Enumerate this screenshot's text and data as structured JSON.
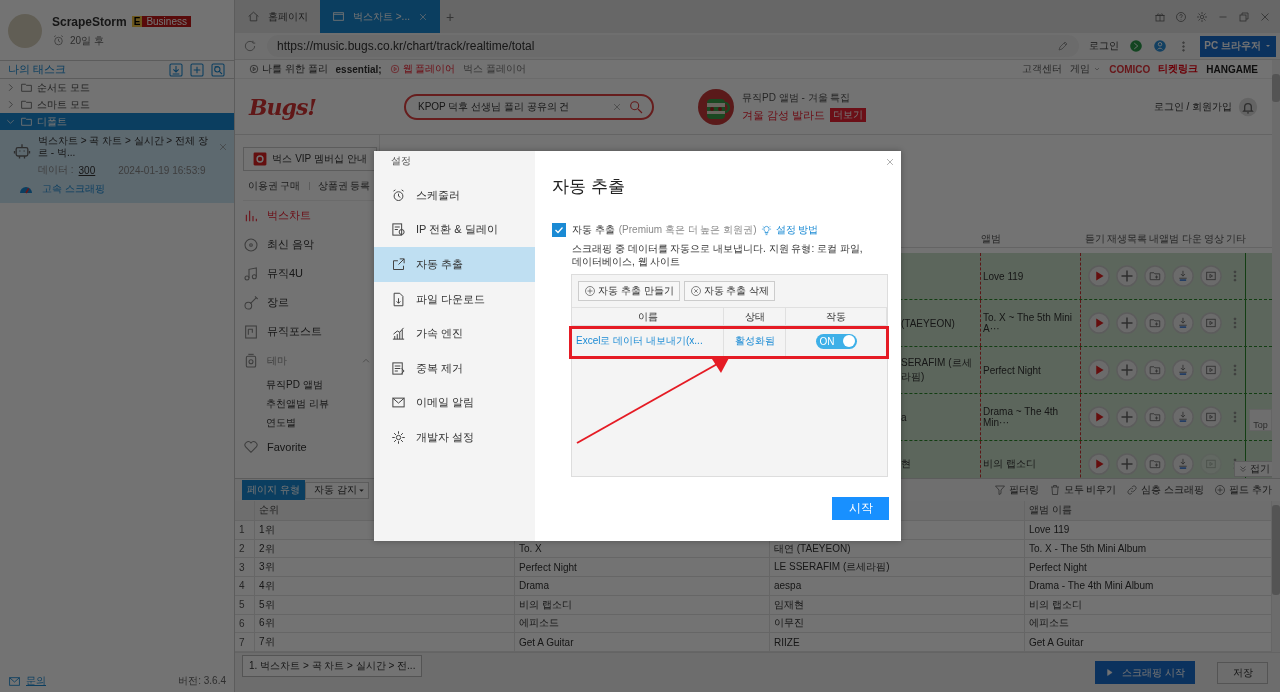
{
  "sidebar": {
    "user": {
      "name": "ScrapeStorm",
      "plan_letter": "E",
      "plan": "Business",
      "expiry": "20일 후"
    },
    "tasks_title": "나의 태스크",
    "tree": [
      {
        "label": "순서도 모드",
        "expanded": false,
        "selected": false
      },
      {
        "label": "스마트 모드",
        "expanded": false,
        "selected": false
      },
      {
        "label": "디폴트",
        "expanded": true,
        "selected": true,
        "children": [
          {
            "title": "벅스차트 > 곡 차트 > 실시간 > 전체 장르 - 벅...",
            "data_label": "데이터 :",
            "data_count": "300",
            "time": "2024-01-19 16:53:9",
            "mode": "고속 스크래핑"
          }
        ]
      }
    ],
    "help": "문의",
    "version": "버전: 3.6.4"
  },
  "browser": {
    "tabs": [
      {
        "label": "홈페이지",
        "selected": false
      },
      {
        "label": "벅스차트 >...",
        "selected": true
      }
    ],
    "new_tab": "+",
    "url": "https://music.bugs.co.kr/chart/track/realtime/total",
    "login": "로그인",
    "browser_mode": "PC 브라우저"
  },
  "web_page": {
    "top_links": [
      {
        "label": "나를 위한 플리",
        "kind": "play"
      },
      {
        "label": "essential;",
        "kind": "bold"
      },
      {
        "label": "웹 플레이어",
        "kind": "player"
      },
      {
        "label": "벅스 플레이어",
        "kind": "plain"
      }
    ],
    "service_links": [
      {
        "label": "고객센터",
        "kind": "plain"
      },
      {
        "label": "게임",
        "kind": "dropdown"
      },
      {
        "label": "COMICO",
        "kind": "comico"
      },
      {
        "label": "티켓링크",
        "kind": "ticket"
      },
      {
        "label": "HANGAME",
        "kind": "hangame"
      }
    ],
    "logo": "Bugs!",
    "search": {
      "value": "KPOP 덕후 선생님 플리 공유의 건"
    },
    "promo": {
      "kicker": "뮤직PD 앨범 - 겨울 특집",
      "title": "겨울 감성 발라드",
      "badge": "더보기"
    },
    "account": "로그인 / 회원가입",
    "vip_button": "벅스 VIP 멤버십 안내",
    "sub_links": [
      "이용권 구매",
      "상품권 등록"
    ],
    "menu": [
      {
        "label": "벅스차트",
        "kind": "item",
        "selected": true
      },
      {
        "label": "최신 음악",
        "kind": "item",
        "selected": false
      },
      {
        "label": "뮤직4U",
        "kind": "item",
        "selected": false
      },
      {
        "label": "장르",
        "kind": "item",
        "selected": false
      },
      {
        "label": "뮤직포스트",
        "kind": "item",
        "selected": false
      },
      {
        "label": "테마",
        "kind": "section",
        "selected": false,
        "expanded": true,
        "children": [
          {
            "label": "뮤직PD 앨범"
          },
          {
            "label": "추천앨범 리뷰"
          },
          {
            "label": "연도별"
          }
        ]
      },
      {
        "label": "Favorite",
        "kind": "item",
        "selected": false
      }
    ],
    "chart": {
      "album_column": "앨범",
      "action_columns": [
        "듣기",
        "재생목록",
        "내앨범",
        "다운",
        "영상",
        "기타"
      ],
      "rows": [
        {
          "album": "Love 119",
          "video_enabled": true
        },
        {
          "artist": "(TAEYEON)",
          "album": "To. X ~ The 5th Mini A···",
          "video_enabled": true
        },
        {
          "artist": "SERAFIM (르세라핌)",
          "album": "Perfect Night",
          "video_enabled": true
        },
        {
          "artist": "a",
          "album": "Drama ~ The 4th Min···",
          "video_enabled": true
        },
        {
          "artist": "현",
          "album": "비의 랩소디",
          "video_enabled": false
        }
      ]
    },
    "top_button": "Top",
    "collapse_button": "접기"
  },
  "bottom_panel": {
    "page_type_label": "페이지 유형",
    "page_type": "자동 감지",
    "tools": [
      "필터링",
      "모두 비우기",
      "심층 스크래핑",
      "필드 추가"
    ],
    "columns": {
      "rank": "순위",
      "album": "앨범 이름"
    },
    "rows": [
      {
        "index": "1",
        "rank": "1위",
        "album": "Love 119"
      },
      {
        "index": "2",
        "rank": "2위",
        "column_2": "To. X",
        "column_3": "태연 (TAEYEON)",
        "album": "To. X - The 5th Mini Album"
      },
      {
        "index": "3",
        "rank": "3위",
        "column_2": "Perfect Night",
        "column_3": "LE SSERAFIM (르세라핌)",
        "album": "Perfect Night"
      },
      {
        "index": "4",
        "rank": "4위",
        "column_2": "Drama",
        "column_3": "aespa",
        "album": "Drama - The 4th Mini Album"
      },
      {
        "index": "5",
        "rank": "5위",
        "column_2": "비의 랩소디",
        "column_3": "임재현",
        "album": "비의 랩소디"
      },
      {
        "index": "6",
        "rank": "6위",
        "column_2": "에피소드",
        "column_3": "이무진",
        "album": "에피소드"
      },
      {
        "index": "7",
        "rank": "7위",
        "column_2": "Get A Guitar",
        "column_3": "RIIZE",
        "album": "Get A Guitar"
      }
    ],
    "breadcrumb": "1. 벅스차트 > 곡 차트 > 실시간 > 전...",
    "start_button": "스크래핑 시작",
    "save_button": "저장"
  },
  "dialog": {
    "title": "설정",
    "menu": [
      {
        "label": "스케줄러",
        "selected": false
      },
      {
        "label": "IP 전환 & 딜레이",
        "selected": false
      },
      {
        "label": "자동 추출",
        "selected": true
      },
      {
        "label": "파일 다운로드",
        "selected": false
      },
      {
        "label": "가속 엔진",
        "selected": false
      },
      {
        "label": "중복 제거",
        "selected": false
      },
      {
        "label": "이메일 알림",
        "selected": false
      },
      {
        "label": "개발자 설정",
        "selected": false
      }
    ],
    "heading": "자동 추출",
    "auto_export": {
      "checked": true,
      "label": "자동 추출",
      "note": "(Premium 혹은 더 높은 회원권)",
      "help_link": "설정 방법",
      "description": "스크래핑 중 데이터를 자동으로 내보냅니다. 지원 유형: 로컬 파일, 데이터베이스, 웹 사이트"
    },
    "buttons": [
      "자동 추출 만들기",
      "자동 추출 삭제"
    ],
    "columns": [
      "이름",
      "상태",
      "작동"
    ],
    "rows": [
      {
        "name": "Excel로 데이터 내보내기(x...",
        "status": "활성화됨",
        "on": true,
        "toggle_label": "ON"
      }
    ],
    "start_button": "시작"
  }
}
